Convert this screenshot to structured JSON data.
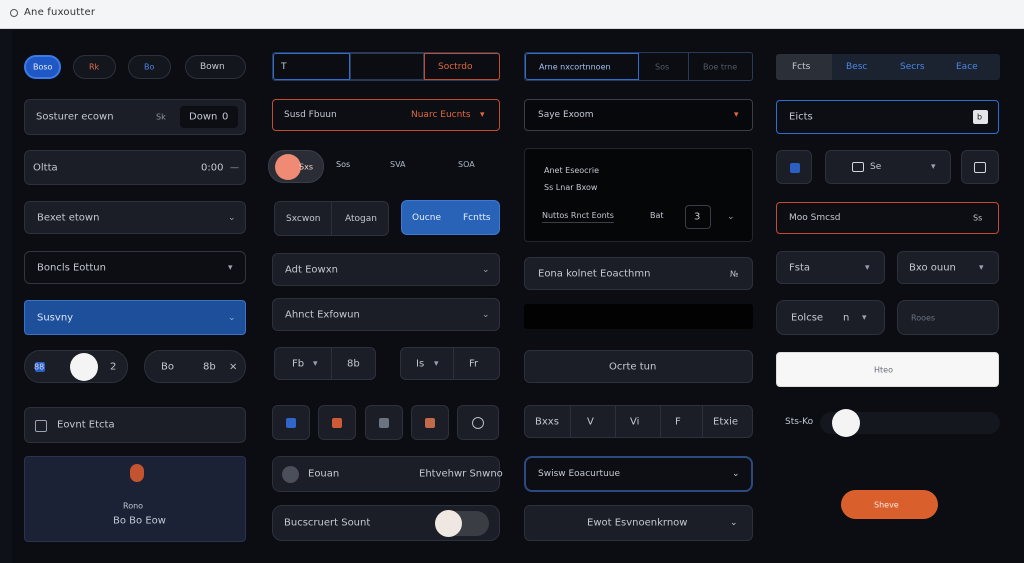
{
  "window": {
    "title": "Ane fuxoutter"
  },
  "col1": {
    "chips": [
      "Boso",
      "Rk",
      "Bo",
      "Bown"
    ],
    "search": {
      "label": "Sosturer ecown",
      "hint": "Sk",
      "btn": "Down",
      "count": "0"
    },
    "field2": {
      "label": "Oltta",
      "value": "0:00"
    },
    "dd1": "Bexet etown",
    "dd2": "Boncls Eottun",
    "dd3": "Susvny",
    "stepper": {
      "left": "88",
      "right": "2"
    },
    "stepper2": {
      "a": "Bo",
      "b": "8b",
      "c": "×"
    },
    "checkbox": "Eovnt Etcta",
    "card": {
      "line1": "Rono",
      "line2": "Bo Bo Eow"
    }
  },
  "col2": {
    "tabs": [
      "T",
      "",
      "Soctrdo"
    ],
    "dd_orange": {
      "label": "Susd Fbuun",
      "value": "Nuarc Eucnts"
    },
    "pills": [
      "Sxs",
      "Sos",
      "SVA",
      "SOA"
    ],
    "seg": [
      "Sxcwon",
      "Atogan"
    ],
    "blue_seg": [
      "Oucne",
      "Fcntts"
    ],
    "dd1": "Adt Eowxn",
    "dd2": "Ahnct Exfowun",
    "step_a": "Fb",
    "step_b": "8b",
    "step_c": "Is",
    "step_d": "Fr",
    "toolbar_icons": [
      "blue",
      "orange",
      "gray",
      "orange2",
      "ring"
    ],
    "row1": {
      "label": "Eouan",
      "value": "Ehtvehwr Snwno"
    },
    "row2": {
      "label": "Bucscruert Sount"
    }
  },
  "col3": {
    "tabs": [
      "Arne nxcortnnoen",
      "Sos",
      "Boe trne"
    ],
    "dd1": "Saye Exoom",
    "card": {
      "l1": "Anet Eseocrie",
      "l2": "Ss Lnar Bxow",
      "l3": "Nuttos Rnct Eonts",
      "btn": "Bat",
      "num": "3"
    },
    "dd2": {
      "label": "Eona kolnet Eoacthmn",
      "icon": "№"
    },
    "button": "Ocrte tun",
    "segbar": [
      "Bxxs",
      "V",
      "Vi",
      "F",
      "Etxie"
    ],
    "dd_blue": "Swisw Eoacurtuue",
    "dd3": "Ewot Esvnoenkrnow"
  },
  "col4": {
    "tabs": [
      "Fcts",
      "Besc",
      "Secrs",
      "Eace"
    ],
    "field": {
      "label": "Eicts",
      "icon": "b"
    },
    "row": {
      "a": "b",
      "b": "Se",
      "c": "B"
    },
    "dd_orange": {
      "label": "Moo Smcsd",
      "icon": "Ss"
    },
    "dd_a": "Fsta",
    "dd_b": "Bxo ouun",
    "dd_c": {
      "label": "Eolcse",
      "mid": "n"
    },
    "input": "Rooes",
    "white": "Hteo",
    "toggle_label": "Sts-Ko",
    "orange_btn": "Sheve"
  }
}
